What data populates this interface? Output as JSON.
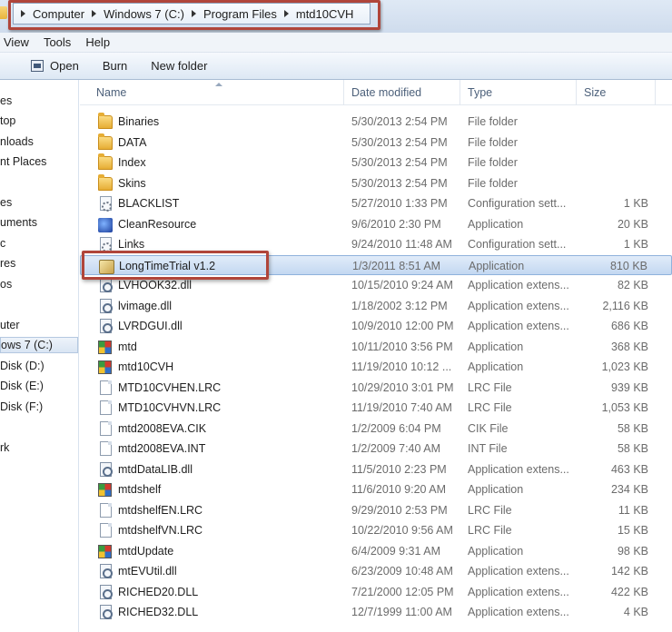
{
  "address": {
    "crumbs": [
      "Computer",
      "Windows 7 (C:)",
      "Program Files",
      "mtd10CVH"
    ]
  },
  "menu": {
    "items": [
      "View",
      "Tools",
      "Help"
    ]
  },
  "toolbar": {
    "open_label": "Open",
    "burn_label": "Burn",
    "new_folder_label": "New folder"
  },
  "nav": {
    "items": [
      "es",
      "top",
      "nloads",
      "nt Places",
      "es",
      "uments",
      "c",
      "res",
      "os",
      "uter",
      "ows 7 (C:)",
      "Disk (D:)",
      "Disk (E:)",
      "Disk (F:)",
      "rk"
    ],
    "selected_index": 10
  },
  "columns": {
    "name": "Name",
    "date": "Date modified",
    "type": "Type",
    "size": "Size"
  },
  "files": [
    {
      "name": "Binaries",
      "date": "5/30/2013 2:54 PM",
      "type": "File folder",
      "size": "",
      "icon": "folder-icon"
    },
    {
      "name": "DATA",
      "date": "5/30/2013 2:54 PM",
      "type": "File folder",
      "size": "",
      "icon": "folder-icon"
    },
    {
      "name": "Index",
      "date": "5/30/2013 2:54 PM",
      "type": "File folder",
      "size": "",
      "icon": "folder-icon"
    },
    {
      "name": "Skins",
      "date": "5/30/2013 2:54 PM",
      "type": "File folder",
      "size": "",
      "icon": "folder-icon"
    },
    {
      "name": "BLACKLIST",
      "date": "5/27/2010 1:33 PM",
      "type": "Configuration sett...",
      "size": "1 KB",
      "icon": "config-file-icon"
    },
    {
      "name": "CleanResource",
      "date": "9/6/2010 2:30 PM",
      "type": "Application",
      "size": "20 KB",
      "icon": "clean-resource-app-icon"
    },
    {
      "name": "Links",
      "date": "9/24/2010 11:48 AM",
      "type": "Configuration sett...",
      "size": "1 KB",
      "icon": "config-file-icon"
    },
    {
      "name": "LongTimeTrial v1.2",
      "date": "1/3/2011 8:51 AM",
      "type": "Application",
      "size": "810 KB",
      "icon": "long-time-trial-app-icon"
    },
    {
      "name": "LVHOOK32.dll",
      "date": "10/15/2010 9:24 AM",
      "type": "Application extens...",
      "size": "82 KB",
      "icon": "dll-file-icon"
    },
    {
      "name": "lvimage.dll",
      "date": "1/18/2002 3:12 PM",
      "type": "Application extens...",
      "size": "2,116 KB",
      "icon": "dll-file-icon"
    },
    {
      "name": "LVRDGUI.dll",
      "date": "10/9/2010 12:00 PM",
      "type": "Application extens...",
      "size": "686 KB",
      "icon": "dll-file-icon"
    },
    {
      "name": "mtd",
      "date": "10/11/2010 3:56 PM",
      "type": "Application",
      "size": "368 KB",
      "icon": "mtd-app-icon"
    },
    {
      "name": "mtd10CVH",
      "date": "11/19/2010 10:12 ...",
      "type": "Application",
      "size": "1,023 KB",
      "icon": "mtd-app-icon"
    },
    {
      "name": "MTD10CVHEN.LRC",
      "date": "10/29/2010 3:01 PM",
      "type": "LRC File",
      "size": "939 KB",
      "icon": "blank-file-icon"
    },
    {
      "name": "MTD10CVHVN.LRC",
      "date": "11/19/2010 7:40 AM",
      "type": "LRC File",
      "size": "1,053 KB",
      "icon": "blank-file-icon"
    },
    {
      "name": "mtd2008EVA.CIK",
      "date": "1/2/2009 6:04 PM",
      "type": "CIK File",
      "size": "58 KB",
      "icon": "blank-file-icon"
    },
    {
      "name": "mtd2008EVA.INT",
      "date": "1/2/2009 7:40 AM",
      "type": "INT File",
      "size": "58 KB",
      "icon": "blank-file-icon"
    },
    {
      "name": "mtdDataLIB.dll",
      "date": "11/5/2010 2:23 PM",
      "type": "Application extens...",
      "size": "463 KB",
      "icon": "dll-file-icon"
    },
    {
      "name": "mtdshelf",
      "date": "11/6/2010 9:20 AM",
      "type": "Application",
      "size": "234 KB",
      "icon": "mtd-app-icon"
    },
    {
      "name": "mtdshelfEN.LRC",
      "date": "9/29/2010 2:53 PM",
      "type": "LRC File",
      "size": "11 KB",
      "icon": "blank-file-icon"
    },
    {
      "name": "mtdshelfVN.LRC",
      "date": "10/22/2010 9:56 AM",
      "type": "LRC File",
      "size": "15 KB",
      "icon": "blank-file-icon"
    },
    {
      "name": "mtdUpdate",
      "date": "6/4/2009 9:31 AM",
      "type": "Application",
      "size": "98 KB",
      "icon": "mtd-app-icon"
    },
    {
      "name": "mtEVUtil.dll",
      "date": "6/23/2009 10:48 AM",
      "type": "Application extens...",
      "size": "142 KB",
      "icon": "dll-file-icon"
    },
    {
      "name": "RICHED20.DLL",
      "date": "7/21/2000 12:05 PM",
      "type": "Application extens...",
      "size": "422 KB",
      "icon": "dll-file-icon"
    },
    {
      "name": "RICHED32.DLL",
      "date": "12/7/1999 11:00 AM",
      "type": "Application extens...",
      "size": "4 KB",
      "icon": "dll-file-icon"
    }
  ],
  "selected_file_index": 7,
  "colors": {
    "highlight_box": "#b0453a",
    "selection_fill": "#cfe0f5"
  }
}
